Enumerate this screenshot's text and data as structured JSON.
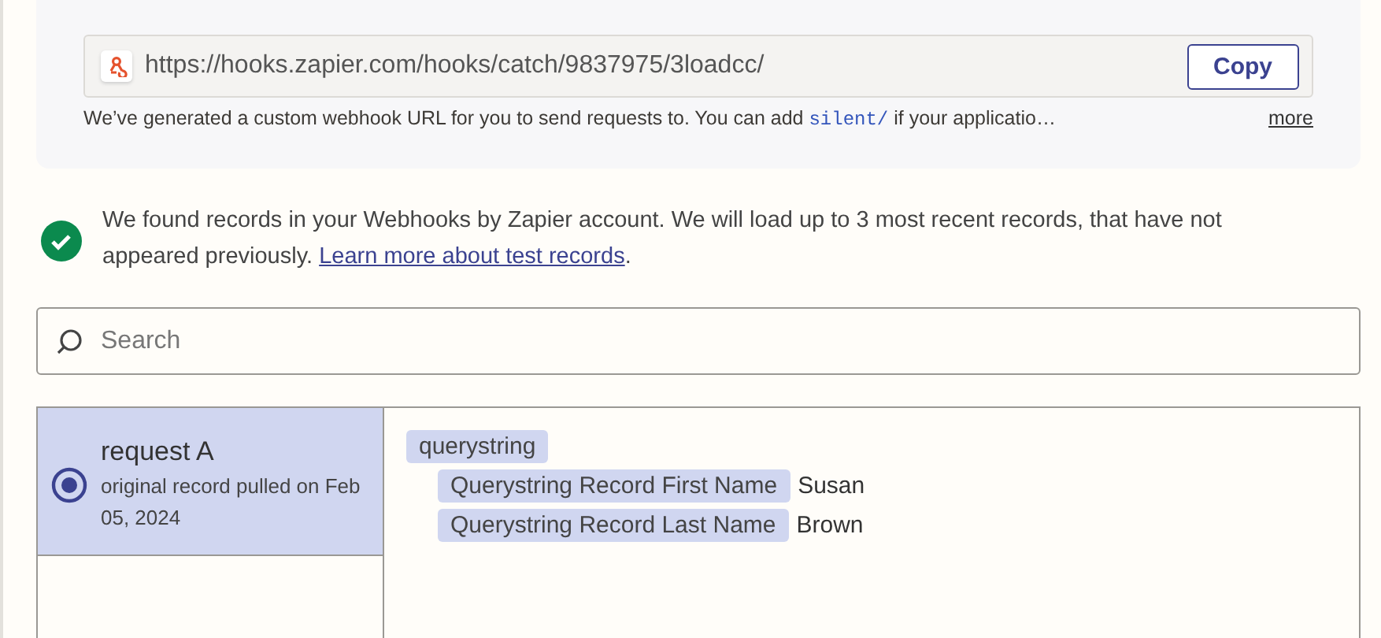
{
  "webhook": {
    "url": "https://hooks.zapier.com/hooks/catch/9837975/3loadcc/",
    "copy_button": "Copy",
    "description": {
      "before": "We’ve generated a custom webhook URL for you to send requests to. You can add",
      "code": "silent/",
      "after": "if your applicatio…"
    },
    "more_link": "more"
  },
  "notice": {
    "text": "We found records in your Webhooks by Zapier account. We will load up to 3 most recent records, that have not appeared previously.",
    "link": "Learn more about test records",
    "after": "."
  },
  "search": {
    "placeholder": "Search"
  },
  "records": [
    {
      "title": "request A",
      "subtitle": "original record pulled on Feb 05, 2024",
      "selected": true
    }
  ],
  "record_fields": [
    {
      "kind": "group",
      "label": "querystring",
      "children": [
        {
          "kind": "field",
          "label": "Querystring Record First Name",
          "value": "Susan"
        },
        {
          "kind": "field",
          "label": "Querystring Record Last Name",
          "value": "Brown"
        }
      ]
    }
  ]
}
